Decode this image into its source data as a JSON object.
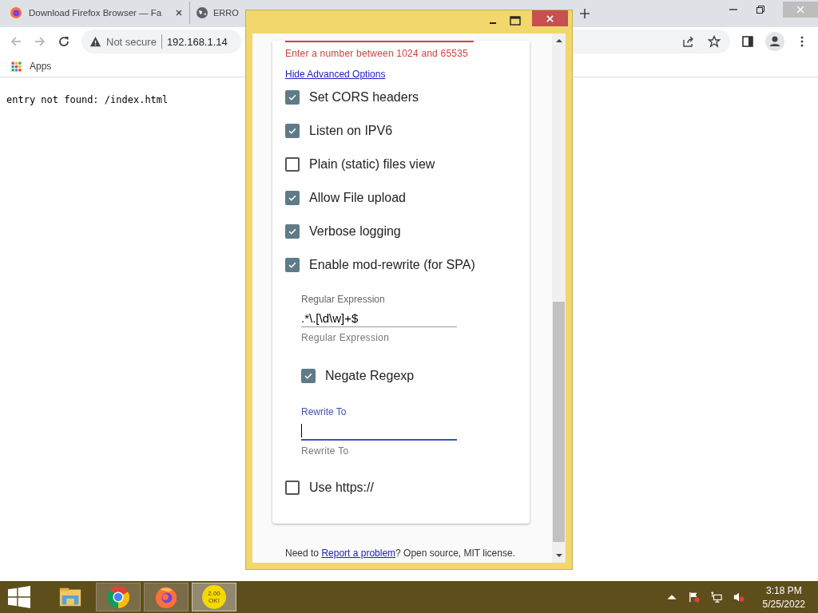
{
  "browser": {
    "tabs": [
      {
        "title": "Download Firefox Browser — Fa",
        "selected": false
      },
      {
        "title": "ERRO",
        "selected": false
      }
    ],
    "address": {
      "security": "Not secure",
      "url": "192.168.1.14"
    },
    "bookmarks": [
      {
        "label": "Apps"
      }
    ],
    "page_text": "entry not found: /index.html"
  },
  "app_window": {
    "port_error": "Enter a number between 1024 and 65535",
    "advanced_link": "Hide Advanced Options",
    "options": [
      {
        "label": "Set CORS headers",
        "checked": true
      },
      {
        "label": "Listen on IPV6",
        "checked": true
      },
      {
        "label": "Plain (static) files view",
        "checked": false
      },
      {
        "label": "Allow File upload",
        "checked": true
      },
      {
        "label": "Verbose logging",
        "checked": true
      },
      {
        "label": "Enable mod-rewrite (for SPA)",
        "checked": true
      }
    ],
    "rewrite_settings": {
      "regex": {
        "label": "Regular Expression",
        "value": ".*\\.[\\d\\w]+$",
        "helper": "Regular Expression",
        "focused": false
      },
      "negate": {
        "label": "Negate Regexp",
        "checked": true
      },
      "rewrite_to": {
        "label": "Rewrite To",
        "helper": "Rewrite To",
        "focused": true
      }
    },
    "https_option": {
      "label": "Use https://",
      "checked": false
    },
    "footer": {
      "prefix": "Need to",
      "link": "Report a problem",
      "suffix": "? Open source, MIT license."
    }
  },
  "taskbar": {
    "apps": [
      {
        "kind": "explorer",
        "running": false,
        "selected": false
      },
      {
        "kind": "chrome",
        "running": true,
        "selected": false
      },
      {
        "kind": "firefox",
        "running": true,
        "selected": false
      },
      {
        "kind": "okserver",
        "running": true,
        "selected": true,
        "badge": "2.00 OK!"
      }
    ],
    "clock": {
      "time": "3:18 PM",
      "date": "5/25/2022"
    }
  }
}
